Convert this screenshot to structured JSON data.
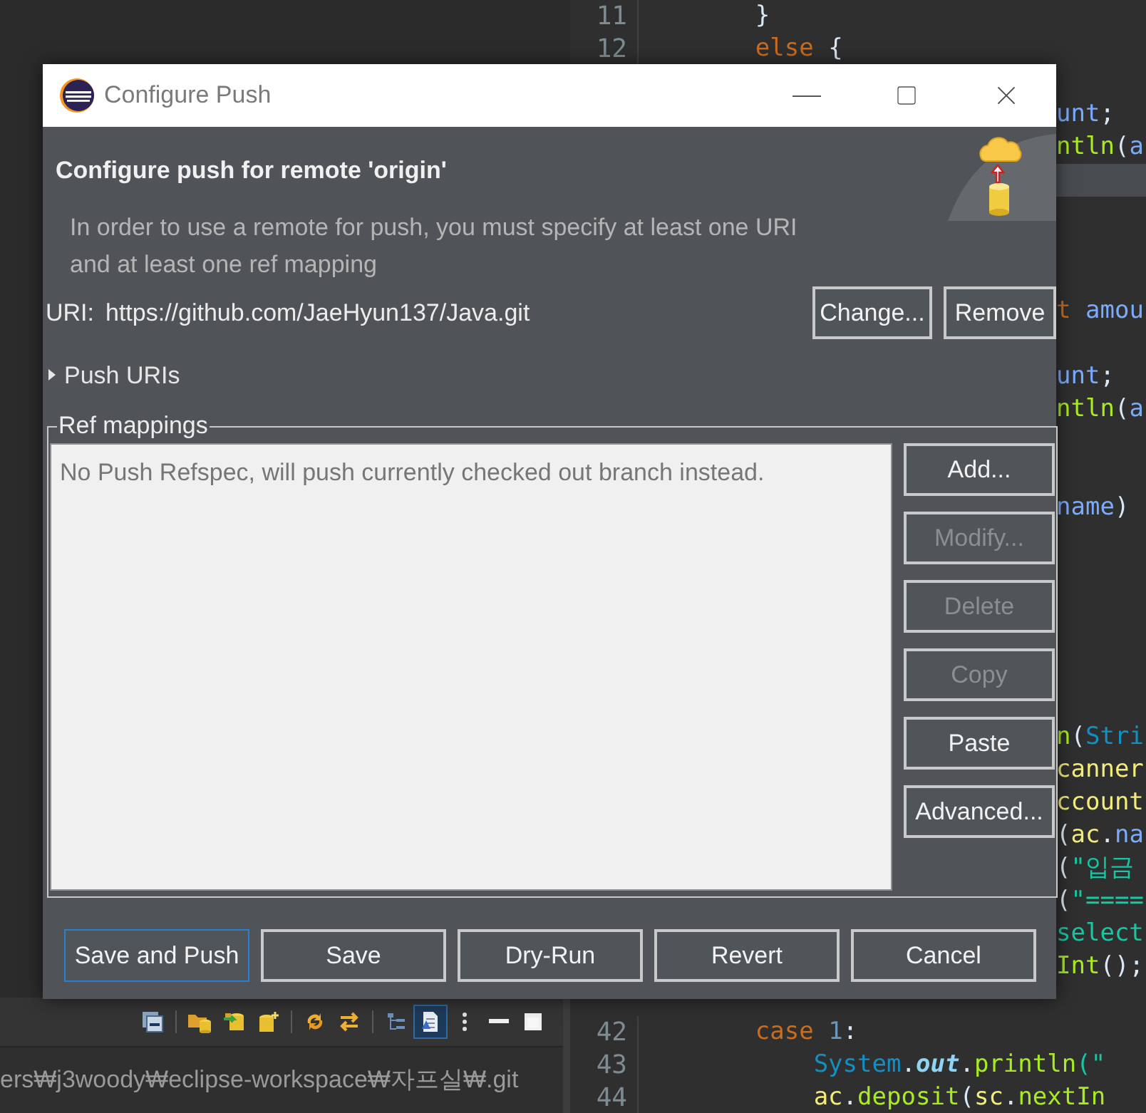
{
  "editor": {
    "lines": [
      {
        "kind": "visible",
        "number": "11",
        "highlighted": false,
        "tokens": [
          {
            "text": "        }",
            "kind": "plain"
          }
        ]
      },
      {
        "kind": "visible",
        "number": "12",
        "highlighted": false,
        "tokens": [
          {
            "text": "        else",
            "kind": "keyword"
          },
          {
            "text": " {",
            "kind": "plain"
          }
        ]
      },
      {
        "kind": "behind_dialog",
        "highlighted": false
      },
      {
        "kind": "behind_dialog",
        "highlighted": false,
        "tokens": [
          {
            "text": "unt",
            "kind": "field"
          },
          {
            "text": ";",
            "kind": "plain"
          }
        ]
      },
      {
        "kind": "behind_dialog",
        "highlighted": false,
        "tokens": [
          {
            "text": "ntln",
            "kind": "method"
          },
          {
            "text": "(",
            "kind": "plain"
          },
          {
            "text": "a",
            "kind": "field"
          }
        ]
      },
      {
        "kind": "behind_dialog",
        "highlighted": true
      },
      {
        "kind": "behind_dialog",
        "highlighted": false
      },
      {
        "kind": "behind_dialog",
        "highlighted": false
      },
      {
        "kind": "behind_dialog",
        "highlighted": false
      },
      {
        "kind": "behind_dialog",
        "highlighted": false,
        "tokens": [
          {
            "text": "t ",
            "kind": "keyword"
          },
          {
            "text": "amou",
            "kind": "field"
          }
        ]
      },
      {
        "kind": "behind_dialog",
        "highlighted": false
      },
      {
        "kind": "behind_dialog",
        "highlighted": false,
        "tokens": [
          {
            "text": "unt",
            "kind": "field"
          },
          {
            "text": ";",
            "kind": "plain"
          }
        ]
      },
      {
        "kind": "behind_dialog",
        "highlighted": false,
        "tokens": [
          {
            "text": "ntln",
            "kind": "method"
          },
          {
            "text": "(",
            "kind": "plain"
          },
          {
            "text": "a",
            "kind": "field"
          }
        ]
      },
      {
        "kind": "behind_dialog",
        "highlighted": false
      },
      {
        "kind": "behind_dialog",
        "highlighted": false
      },
      {
        "kind": "behind_dialog",
        "highlighted": false,
        "tokens": [
          {
            "text": "name",
            "kind": "field"
          },
          {
            "text": ")",
            "kind": "plain"
          }
        ]
      },
      {
        "kind": "behind_dialog",
        "highlighted": false
      },
      {
        "kind": "behind_dialog",
        "highlighted": false
      },
      {
        "kind": "behind_dialog",
        "highlighted": false
      },
      {
        "kind": "behind_dialog",
        "highlighted": false
      },
      {
        "kind": "behind_dialog",
        "highlighted": false
      },
      {
        "kind": "behind_dialog",
        "highlighted": false
      },
      {
        "kind": "behind_dialog",
        "highlighted": false,
        "tokens": [
          {
            "text": "n",
            "kind": "method"
          },
          {
            "text": "(",
            "kind": "plain"
          },
          {
            "text": "Stri",
            "kind": "type"
          }
        ]
      },
      {
        "kind": "behind_dialog",
        "highlighted": false,
        "tokens": [
          {
            "text": "canner",
            "kind": "local"
          }
        ]
      },
      {
        "kind": "behind_dialog",
        "highlighted": false,
        "tokens": [
          {
            "text": "ccount",
            "kind": "local"
          }
        ]
      },
      {
        "kind": "behind_dialog",
        "highlighted": false,
        "tokens": [
          {
            "text": "(",
            "kind": "plain"
          },
          {
            "text": "ac",
            "kind": "local"
          },
          {
            "text": ".",
            "kind": "plain"
          },
          {
            "text": "na",
            "kind": "field"
          }
        ]
      },
      {
        "kind": "behind_dialog",
        "highlighted": false,
        "tokens": [
          {
            "text": "(",
            "kind": "plain"
          },
          {
            "text": "\"입금",
            "kind": "string"
          }
        ]
      },
      {
        "kind": "behind_dialog",
        "highlighted": false,
        "tokens": [
          {
            "text": "(",
            "kind": "plain"
          },
          {
            "text": "\"====",
            "kind": "string"
          }
        ]
      },
      {
        "kind": "behind_dialog",
        "highlighted": false,
        "tokens": [
          {
            "text": "select",
            "kind": "string"
          }
        ]
      },
      {
        "kind": "behind_dialog",
        "highlighted": false,
        "tokens": [
          {
            "text": "Int",
            "kind": "method"
          },
          {
            "text": "();",
            "kind": "plain"
          }
        ]
      },
      {
        "kind": "behind_dialog",
        "highlighted": false
      },
      {
        "kind": "visible",
        "number": "42",
        "highlighted": false,
        "tokens": [
          {
            "text": "        case",
            "kind": "keyword"
          },
          {
            "text": " 1",
            "kind": "number"
          },
          {
            "text": ":",
            "kind": "plain"
          }
        ]
      },
      {
        "kind": "visible",
        "number": "43",
        "highlighted": false,
        "tokens": [
          {
            "text": "            System",
            "kind": "type"
          },
          {
            "text": ".",
            "kind": "plain"
          },
          {
            "text": "out",
            "kind": "static"
          },
          {
            "text": ".",
            "kind": "plain"
          },
          {
            "text": "println",
            "kind": "method"
          },
          {
            "text": "(\"",
            "kind": "string"
          }
        ]
      },
      {
        "kind": "visible",
        "number": "44",
        "highlighted": false,
        "tokens": [
          {
            "text": "            ac",
            "kind": "local"
          },
          {
            "text": ".",
            "kind": "plain"
          },
          {
            "text": "deposit",
            "kind": "method"
          },
          {
            "text": "(",
            "kind": "plain"
          },
          {
            "text": "sc",
            "kind": "local"
          },
          {
            "text": ".",
            "kind": "plain"
          },
          {
            "text": "nextIn",
            "kind": "method"
          }
        ]
      }
    ]
  },
  "repositories_panel": {
    "toolbar": [
      {
        "kind": "collapse",
        "selected": false
      },
      {
        "kind": "separator"
      },
      {
        "kind": "folder_db",
        "selected": false
      },
      {
        "kind": "db_arrow",
        "selected": false
      },
      {
        "kind": "db_plus",
        "selected": false
      },
      {
        "kind": "separator"
      },
      {
        "kind": "sync",
        "selected": false
      },
      {
        "kind": "swap",
        "selected": false
      },
      {
        "kind": "separator"
      },
      {
        "kind": "tree",
        "selected": false
      },
      {
        "kind": "document",
        "selected": true
      },
      {
        "kind": "kebab",
        "selected": false
      },
      {
        "kind": "minimize",
        "selected": false
      },
      {
        "kind": "maximize",
        "selected": false
      }
    ],
    "path": "ers₩j3woody₩eclipse-workspace₩자프실₩.git"
  },
  "dialog": {
    "title": "Configure Push",
    "heading": "Configure push for remote 'origin'",
    "description": "In order to use a remote for push, you must specify at least one URI and at least one ref mapping",
    "uri_label": "URI:",
    "uri": "https://github.com/JaeHyun137/Java.git",
    "uri_buttons": [
      {
        "label": "Change...",
        "disabled": false
      },
      {
        "label": "Remove",
        "disabled": false
      }
    ],
    "push_uris": {
      "label": "Push URIs",
      "expanded": false
    },
    "ref_mappings": {
      "title": "Ref mappings",
      "empty_message": "No Push Refspec, will push currently checked out branch instead.",
      "buttons": [
        {
          "label": "Add...",
          "disabled": false
        },
        {
          "label": "Modify...",
          "disabled": true
        },
        {
          "label": "Delete",
          "disabled": true
        },
        {
          "label": "Copy",
          "disabled": true
        },
        {
          "label": "Paste",
          "disabled": false
        },
        {
          "label": "Advanced...",
          "disabled": false
        }
      ]
    },
    "footer_buttons": [
      {
        "label": "Save and Push",
        "focused": true
      },
      {
        "label": "Save",
        "focused": false
      },
      {
        "label": "Dry-Run",
        "focused": false
      },
      {
        "label": "Revert",
        "focused": false
      },
      {
        "label": "Cancel",
        "focused": false
      }
    ]
  }
}
